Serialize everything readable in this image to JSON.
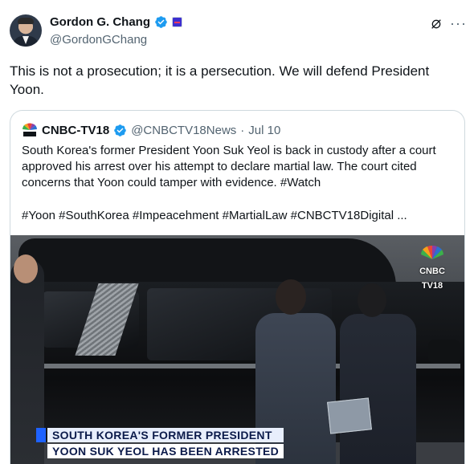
{
  "author": {
    "display_name": "Gordon G. Chang",
    "handle": "@GordonGChang"
  },
  "tweet": {
    "text": "This is not a prosecution; it is a persecution. We will defend President Yoon."
  },
  "quoted": {
    "display_name": "CNBC-TV18",
    "handle": "@CNBCTV18News",
    "separator": "·",
    "date": "Jul 10",
    "text": "South Korea's former President Yoon Suk Yeol is back in custody after a court approved his arrest over his attempt to declare martial law. The court cited concerns that Yoon could tamper with evidence. #Watch",
    "hashtags": "#Yoon #SouthKorea #Impeacehment #MartialLaw #CNBCTV18Digital ...",
    "video": {
      "bug_line1": "CNBC",
      "bug_line2": "TV18",
      "headline_line1": "SOUTH KOREA'S FORMER PRESIDENT",
      "headline_line2": "YOON SUK YEOL HAS BEEN ARRESTED"
    }
  },
  "icons": {
    "verified": "verified-badge-icon",
    "affiliation": "affiliation-badge-icon",
    "grok": "grok-icon",
    "more": "more-icon"
  },
  "colors": {
    "verified_blue": "#1d9bf0",
    "secondary_text": "#536471",
    "border": "#cfd9de"
  }
}
